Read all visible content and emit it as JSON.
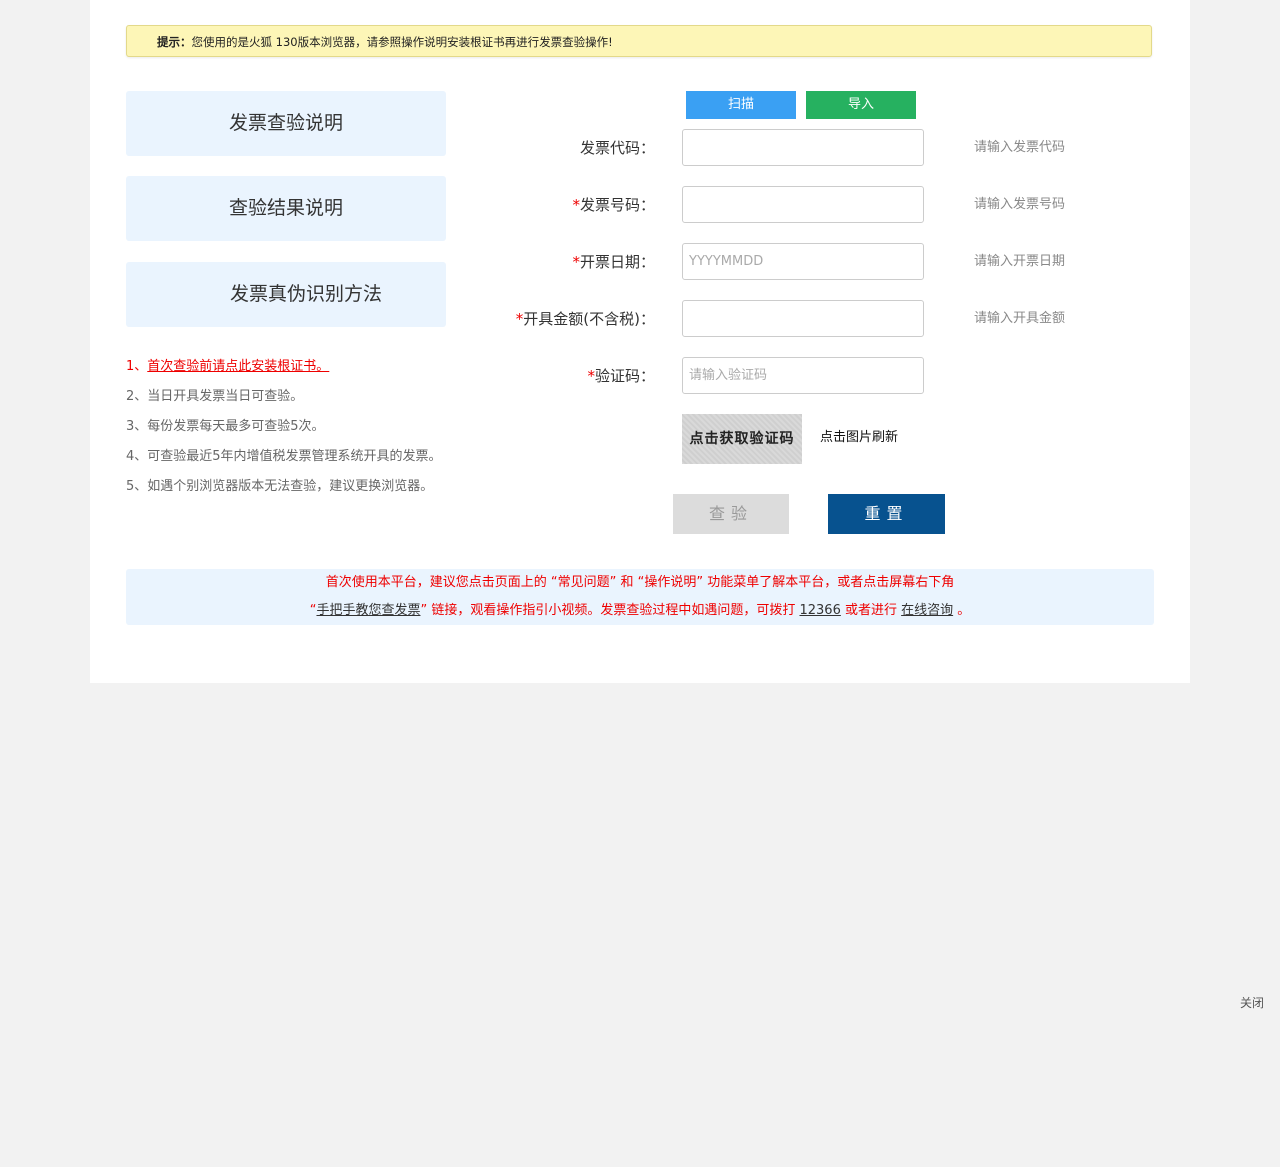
{
  "tip": {
    "prefix": "提示：",
    "text": "您使用的是火狐 130版本浏览器，请参照操作说明安装根证书再进行发票查验操作!"
  },
  "side_buttons": {
    "invoice_check_desc": "发票查验说明",
    "result_desc": "查验结果说明",
    "authenticity_method": "发票真伪识别方法"
  },
  "notes": [
    {
      "num": "1、",
      "text": "首次查验前请点此安装根证书。"
    },
    {
      "text": "2、当日开具发票当日可查验。"
    },
    {
      "text": "3、每份发票每天最多可查验5次。"
    },
    {
      "text": "4、可查验最近5年内增值税发票管理系统开具的发票。"
    },
    {
      "text": "5、如遇个别浏览器版本无法查验，建议更换浏览器。"
    }
  ],
  "actions": {
    "scan": "扫描",
    "import": "导入"
  },
  "form": {
    "invoice_code": {
      "star": "",
      "label": "发票代码：",
      "value": "",
      "placeholder": "",
      "hint": "请输入发票代码"
    },
    "invoice_number": {
      "star": "*",
      "label": "发票号码：",
      "value": "",
      "placeholder": "",
      "hint": "请输入发票号码"
    },
    "issue_date": {
      "star": "*",
      "label": "开票日期：",
      "value": "",
      "placeholder": "YYYYMMDD",
      "hint": "请输入开票日期"
    },
    "amount": {
      "star": "*",
      "label": "开具金额(不含税)：",
      "value": "",
      "placeholder": "",
      "hint": "请输入开具金额"
    },
    "captcha": {
      "star": "*",
      "label": "验证码：",
      "value": "",
      "placeholder": "请输入验证码"
    }
  },
  "captcha_image_text": "点击获取验证码",
  "refresh_text": "点击图片刷新",
  "buttons": {
    "check": "查验",
    "reset": "重置"
  },
  "notice": {
    "line1": "首次使用本平台，建议您点击页面上的 “常见问题” 和 “操作说明” 功能菜单了解本平台，或者点击屏幕右下角",
    "line2_open_quote": "“",
    "line2_link_tutorial": "手把手教您查发票",
    "line2_mid": "” 链接，观看操作指引小视频。发票查验过程中如遇问题，可拨打 ",
    "line2_phone": "12366",
    "line2_or": " 或者进行 ",
    "line2_link_consult": "在线咨询",
    "line2_end": " 。"
  },
  "close": "关闭"
}
